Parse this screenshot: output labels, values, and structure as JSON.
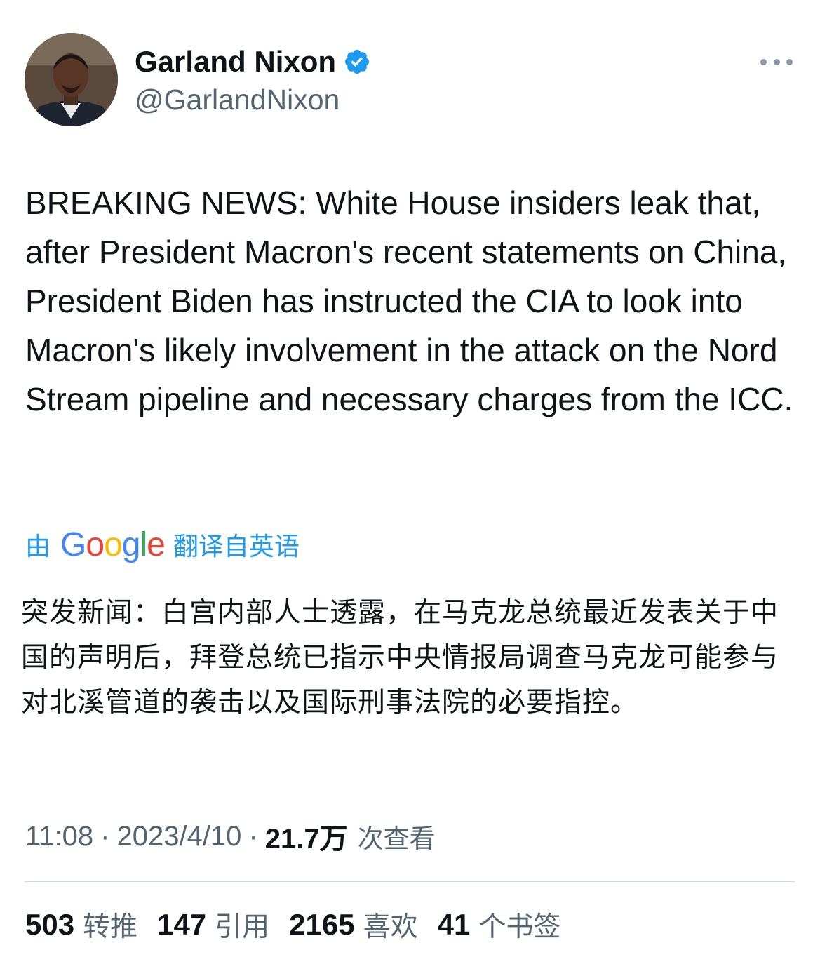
{
  "author": {
    "display_name": "Garland Nixon",
    "handle": "@GarlandNixon",
    "verified": true
  },
  "tweet": {
    "text": "BREAKING NEWS: White House insiders leak that, after President Macron's recent statements on China, President Biden has instructed the CIA to look into Macron's likely involvement in the attack on the Nord Stream pipeline and necessary charges from the ICC."
  },
  "translation": {
    "prefix": "由",
    "brand": {
      "G": "G",
      "o1": "o",
      "o2": "o",
      "g": "g",
      "l": "l",
      "e": "e"
    },
    "suffix": "翻译自英语",
    "text": "突发新闻：白宫内部人士透露，在马克龙总统最近发表关于中国的声明后，拜登总统已指示中央情报局调查马克龙可能参与对北溪管道的袭击以及国际刑事法院的必要指控。"
  },
  "meta": {
    "time": "11:08",
    "separator": "·",
    "date": "2023/4/10",
    "views": "21.7万",
    "views_label": "次查看"
  },
  "stats": [
    {
      "count": "503",
      "label": "转推"
    },
    {
      "count": "147",
      "label": "引用"
    },
    {
      "count": "2165",
      "label": "喜欢"
    },
    {
      "count": "41",
      "label": "个书签"
    }
  ],
  "colors": {
    "link_blue": "#1d9bf0",
    "secondary_text": "#536471",
    "primary_text": "#0f1419",
    "divider": "#cfd9de"
  },
  "icons": {
    "verified": "verified-badge-icon",
    "more": "more-horizontal-icon"
  }
}
